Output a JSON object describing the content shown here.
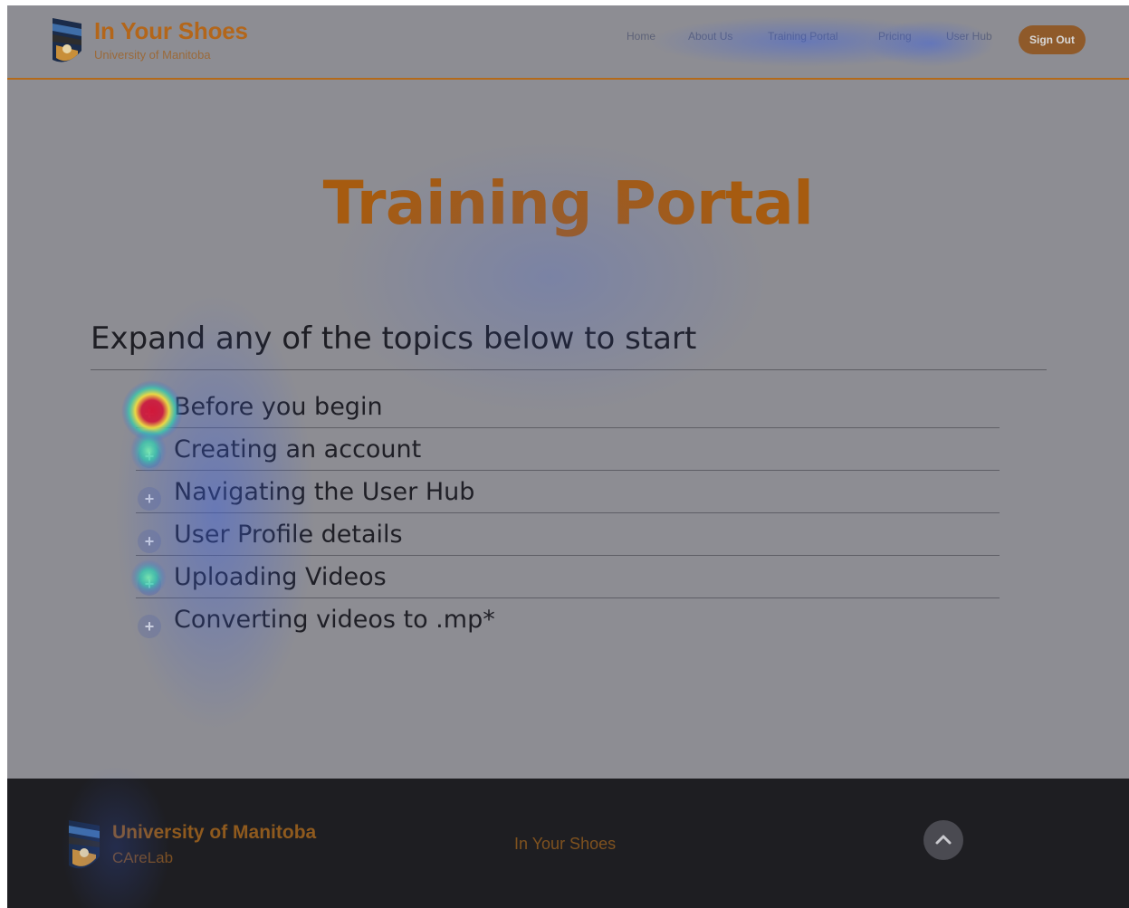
{
  "header": {
    "brand_title": "In Your Shoes",
    "brand_sub": "University of Manitoba",
    "nav": [
      "Home",
      "About Us",
      "Training Portal",
      "Pricing",
      "User Hub"
    ],
    "signout_label": "Sign Out"
  },
  "main": {
    "title": "Training Portal",
    "section_heading": "Expand any of the topics below to start",
    "topics": [
      "Before you begin",
      "Creating an account",
      "Navigating the User Hub",
      "User Profile details",
      "Uploading Videos",
      "Converting videos to .mp*"
    ]
  },
  "footer": {
    "title": "University of Manitoba",
    "sub": "CAreLab",
    "center": "In Your Shoes"
  },
  "icons": {
    "logo": "university-crest-icon",
    "expand": "plus-circle-icon",
    "back_to_top": "chevron-up-icon"
  },
  "colors": {
    "brand": "#b3661a",
    "footer_bg": "#1e1e22",
    "overlay_bg": "#8d8d93",
    "heat_hot": "#d1183a",
    "heat_warm": "#f5e13c",
    "heat_cool": "#2fd1b0",
    "heat_base": "#3a5fe0"
  }
}
